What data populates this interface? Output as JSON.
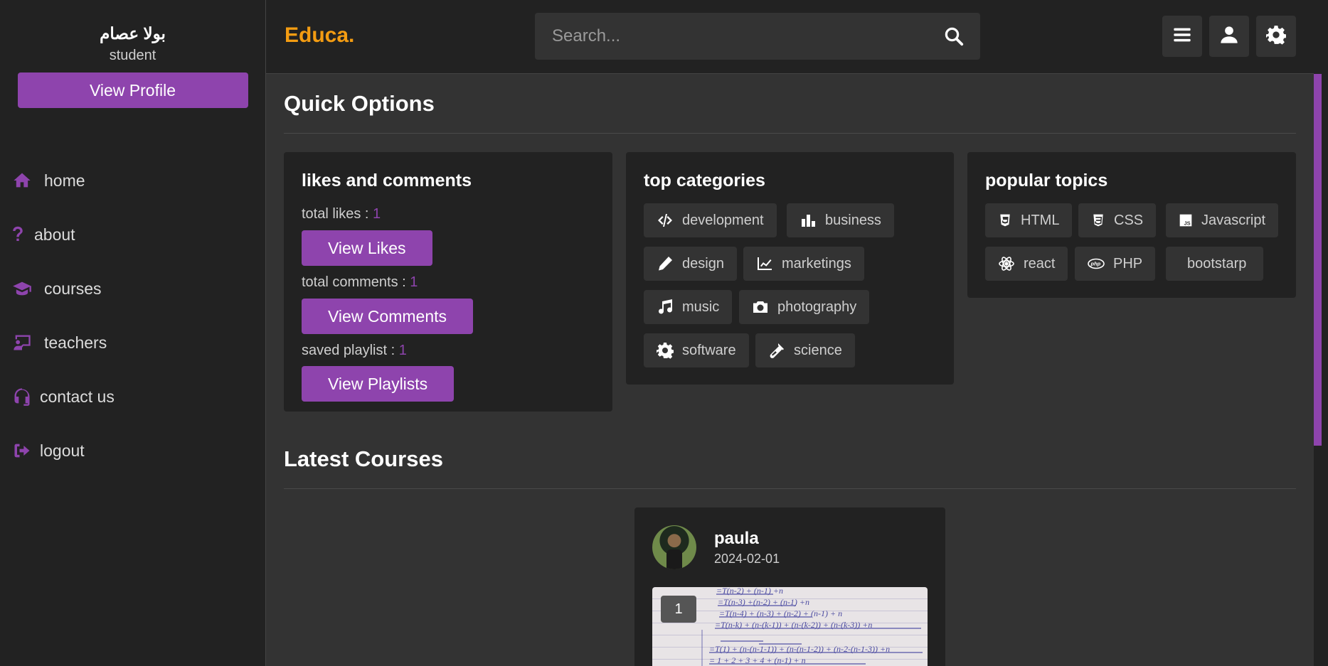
{
  "sidebar": {
    "profile_name": "بولا عصام",
    "profile_role": "student",
    "view_profile_label": "View Profile",
    "items": [
      {
        "label": "home",
        "icon": "home-icon"
      },
      {
        "label": "about",
        "icon": "question-icon"
      },
      {
        "label": "courses",
        "icon": "graduation-cap-icon"
      },
      {
        "label": "teachers",
        "icon": "chalkboard-teacher-icon"
      },
      {
        "label": "contact us",
        "icon": "headset-icon"
      },
      {
        "label": "logout",
        "icon": "logout-icon"
      }
    ]
  },
  "header": {
    "logo": "Educa.",
    "search_placeholder": "Search...",
    "buttons": [
      "menu-icon",
      "user-icon",
      "gear-icon"
    ]
  },
  "quick_options": {
    "title": "Quick Options",
    "likes_box": {
      "title": "likes and comments",
      "likes_label": "total likes : ",
      "likes_value": "1",
      "view_likes": "View Likes",
      "comments_label": "total comments : ",
      "comments_value": "1",
      "view_comments": "View Comments",
      "playlist_label": "saved playlist : ",
      "playlist_value": "1",
      "view_playlists": "View Playlists"
    },
    "categories_box": {
      "title": "top categories",
      "tags": [
        {
          "label": "development",
          "icon": "code-icon"
        },
        {
          "label": "business",
          "icon": "chart-bar-icon"
        },
        {
          "label": "design",
          "icon": "pen-icon"
        },
        {
          "label": "marketings",
          "icon": "chart-line-icon"
        },
        {
          "label": "music",
          "icon": "music-icon"
        },
        {
          "label": "photography",
          "icon": "camera-icon"
        },
        {
          "label": "software",
          "icon": "cog-icon"
        },
        {
          "label": "science",
          "icon": "vial-icon"
        }
      ]
    },
    "topics_box": {
      "title": "popular topics",
      "tags": [
        {
          "label": "HTML",
          "icon": "html5-icon"
        },
        {
          "label": "CSS",
          "icon": "css3-icon"
        },
        {
          "label": "Javascript",
          "icon": "js-icon"
        },
        {
          "label": "react",
          "icon": "react-icon"
        },
        {
          "label": "PHP",
          "icon": "php-icon"
        },
        {
          "label": "bootstarp",
          "icon": "bootstrap-icon"
        }
      ]
    }
  },
  "latest_courses": {
    "title": "Latest Courses",
    "courses": [
      {
        "tutor": "paula",
        "date": "2024-02-01",
        "videos_count": "1"
      }
    ]
  },
  "colors": {
    "accent": "#8e44ad",
    "logo": "#f39c12",
    "panel": "#222222",
    "background": "#333333"
  }
}
